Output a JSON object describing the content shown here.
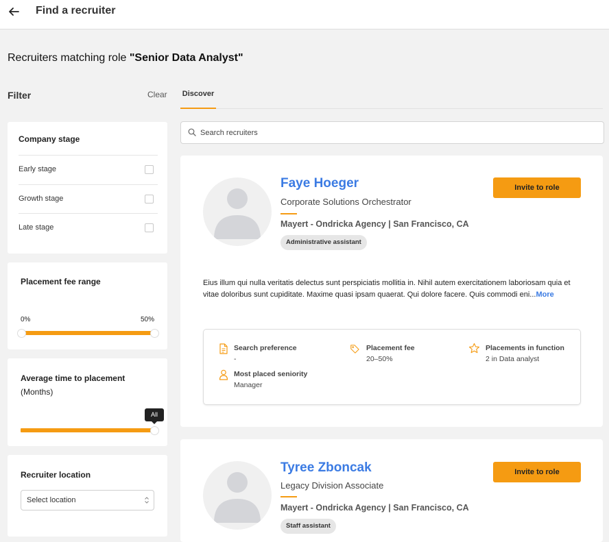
{
  "header": {
    "back_icon": "arrow-left-icon",
    "title": "Find a recruiter"
  },
  "heading": {
    "prefix": "Recruiters matching role ",
    "role": "\"Senior Data Analyst\""
  },
  "filter": {
    "title": "Filter",
    "clear_label": "Clear",
    "company_stage": {
      "title": "Company stage",
      "options": [
        {
          "label": "Early stage",
          "checked": false
        },
        {
          "label": "Growth stage",
          "checked": false
        },
        {
          "label": "Late stage",
          "checked": false
        }
      ]
    },
    "placement_fee": {
      "title": "Placement fee range",
      "min_label": "0%",
      "max_label": "50%"
    },
    "avg_time": {
      "title": "Average time to placement",
      "subtitle": "(Months)",
      "tooltip": "All"
    },
    "location": {
      "title": "Recruiter location",
      "placeholder": "Select location"
    }
  },
  "tabs": [
    {
      "label": "Discover",
      "active": true
    }
  ],
  "search": {
    "placeholder": "Search recruiters"
  },
  "recruiters": [
    {
      "name": "Faye Hoeger",
      "title": "Corporate Solutions Orchestrator",
      "agency": "Mayert - Ondricka Agency | San Francisco, CA",
      "badge": "Administrative assistant",
      "invite_label": "Invite to role",
      "bio": "Eius illum qui nulla veritatis delectus sunt perspiciatis mollitia in. Nihil autem exercitationem laboriosam quia et vitae doloribus sunt cupiditate. Maxime quasi ipsam quaerat. Qui dolore facere. Quis commodi eni...",
      "more_label": "More",
      "stats": {
        "search_preference_label": "Search preference",
        "search_preference_value": "-",
        "placement_fee_label": "Placement fee",
        "placement_fee_value": "20–50%",
        "placements_label": "Placements in function",
        "placements_value": "2 in Data analyst",
        "seniority_label": "Most placed seniority",
        "seniority_value": "Manager"
      }
    },
    {
      "name": "Tyree Zboncak",
      "title": "Legacy Division Associate",
      "agency": "Mayert - Ondricka Agency | San Francisco, CA",
      "badge": "Staff assistant",
      "invite_label": "Invite to role"
    }
  ],
  "colors": {
    "accent": "#f59b12",
    "link": "#3b7be3",
    "background": "#f2f2f2"
  }
}
